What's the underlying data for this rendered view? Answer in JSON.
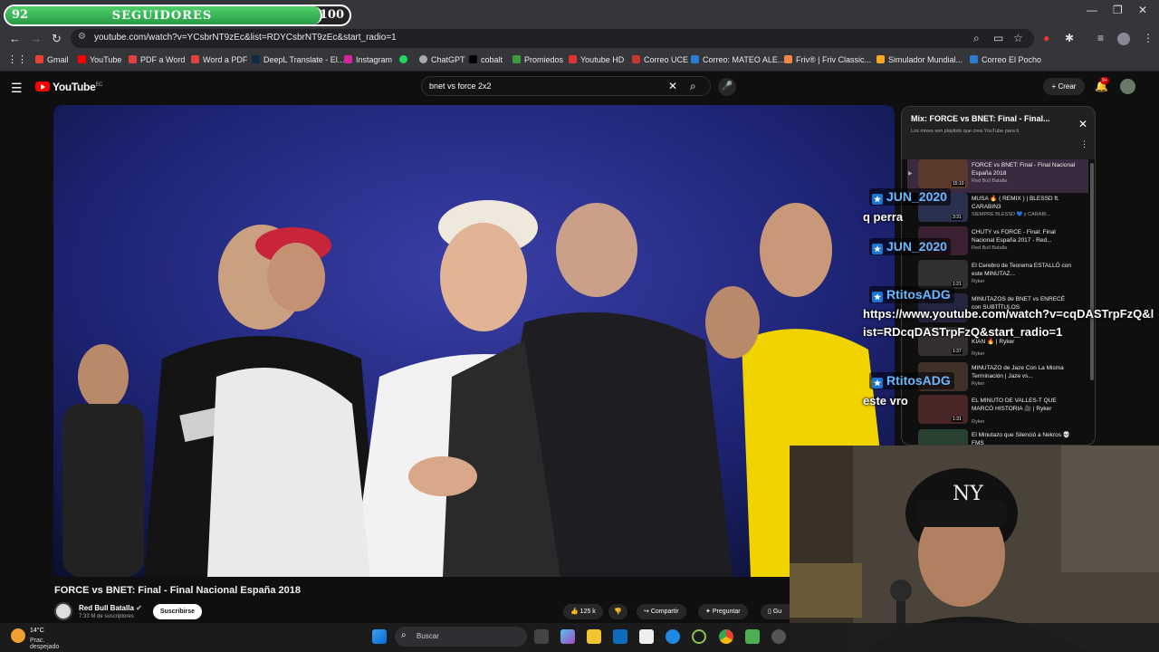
{
  "follow_bar": {
    "current": "92",
    "label": "SEGUIDORES",
    "goal": "100",
    "progress": 0.92
  },
  "browser": {
    "url": "youtube.com/watch?v=YCsbrNT9zEc&list=RDYCsbrNT9zEc&start_radio=1",
    "bookmarks": [
      "Gmail",
      "YouTube",
      "PDF a Word",
      "Word a PDF",
      "DeepL Translate - El...",
      "Instagram",
      "ChatGPT",
      "cobalt",
      "Promiedos",
      "Youtube HD",
      "Correo UCE",
      "Correo: MATEO ALE...",
      "Friv® | Friv Classic...",
      "Simulador Mundial...",
      "Correo El Pocho"
    ]
  },
  "youtube": {
    "logo": "YouTube",
    "country": "EC",
    "search_query": "bnet vs force 2x2",
    "create_label": "Crear",
    "notif_count": "9+",
    "video_title": "FORCE vs BNET: Final - Final Nacional España 2018",
    "channel": "Red Bull Batalla",
    "subscribers": "7.33 M de suscriptores",
    "subscribe_label": "Suscribirse",
    "likes": "125 k",
    "share_label": "Compartir",
    "ask_label": "Preguntar",
    "save_label": "Gu"
  },
  "playlist": {
    "title": "Mix: FORCE vs BNET: Final - Final...",
    "subtitle": "Los mixes son playlists que crea YouTube para ti",
    "items": [
      {
        "title": "FORCE vs BNET: Final - Final Nacional España 2018",
        "channel": "Red Bull Batalla",
        "duration": "15:10"
      },
      {
        "title": "MUSA 🔥 ( REMIX ) | BLESSD ft. CARABIN3",
        "channel": "SIEMPRE BLESSD 💙 y CARABI...",
        "duration": "3:31"
      },
      {
        "title": "CHUTY vs FORCE - Final: Final Nacional España 2017 - Red...",
        "channel": "Red Bull Batalla",
        "duration": ""
      },
      {
        "title": "El Cerebro de Teorema ESTALLÓ con este MINUTAZ...",
        "channel": "Ryker",
        "duration": "1:21"
      },
      {
        "title": "MINUTAZOS de BNET vs ENRECÉ con SUBTÍTULOS",
        "channel": "",
        "duration": ""
      },
      {
        "title": "KIAN 🔥 | Ryker",
        "channel": "Ryker",
        "duration": "1:37"
      },
      {
        "title": "MINUTAZO de Jaze Con La Misma Terminación | Jaze vs...",
        "channel": "Ryker",
        "duration": ""
      },
      {
        "title": "EL MINUTO DE VALLES-T QUE MARCÓ HISTORIA 🎥 | Ryker",
        "channel": "Ryker",
        "duration": "1:31"
      },
      {
        "title": "El Minutazo que Silenció a Nekros 💀 FMS",
        "channel": "",
        "duration": ""
      }
    ]
  },
  "chat": [
    {
      "user": "JUN_2020",
      "message": "q perra"
    },
    {
      "user": "JUN_2020",
      "message": ""
    },
    {
      "user": "RtitosADG",
      "message": "https://www.youtube.com/watch?v=cqDASTrpFzQ&list=RDcqDASTrpFzQ&start_radio=1"
    },
    {
      "user": "RtitosADG",
      "message": "este vro"
    }
  ],
  "taskbar": {
    "temp": "14°C",
    "weather": "Prac. despejado",
    "search": "Buscar"
  }
}
